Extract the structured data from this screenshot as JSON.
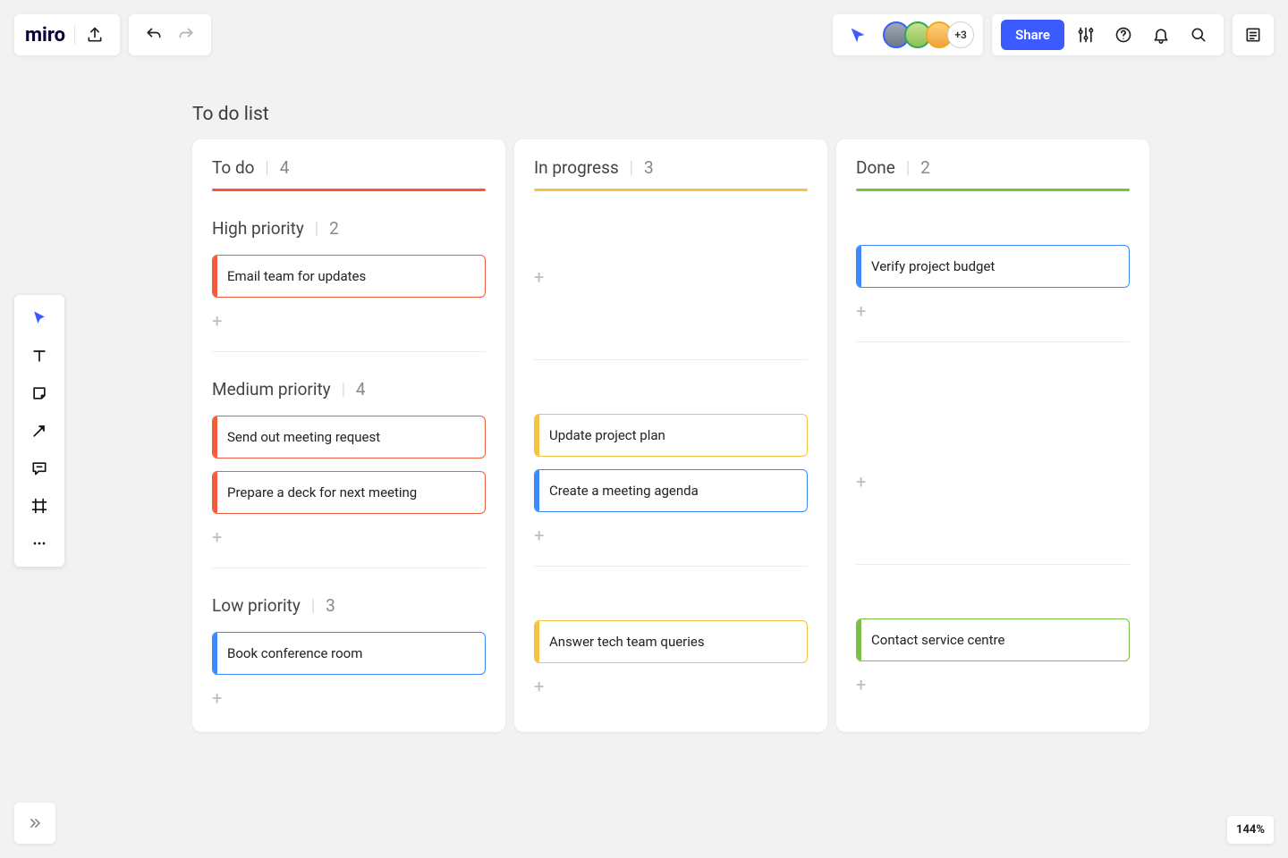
{
  "app": {
    "logo_text": "miro"
  },
  "topbar": {
    "overflow_count": "+3",
    "share_label": "Share"
  },
  "board": {
    "title": "To do list",
    "columns": [
      {
        "name": "To do",
        "count": 4,
        "underline_color": "#f35c3a"
      },
      {
        "name": "In progress",
        "count": 3,
        "underline_color": "#f5c242"
      },
      {
        "name": "Done",
        "count": 2,
        "underline_color": "#7bc043"
      }
    ],
    "sections": [
      {
        "name": "High priority",
        "count": 2
      },
      {
        "name": "Medium priority",
        "count": 4
      },
      {
        "name": "Low priority",
        "count": 3
      }
    ],
    "cards": {
      "todo_high": [
        {
          "text": "Email team for updates",
          "color": "red"
        }
      ],
      "todo_medium": [
        {
          "text": "Send out meeting request",
          "color": "red"
        },
        {
          "text": "Prepare a deck for next meeting",
          "color": "red"
        }
      ],
      "todo_low": [
        {
          "text": "Book conference room",
          "color": "blue"
        }
      ],
      "prog_medium": [
        {
          "text": "Update project plan",
          "color": "yellow"
        },
        {
          "text": "Create a meeting agenda",
          "color": "blue"
        }
      ],
      "prog_low": [
        {
          "text": "Answer tech team queries",
          "color": "yellow"
        }
      ],
      "done_high": [
        {
          "text": "Verify project budget",
          "color": "blue"
        }
      ],
      "done_low": [
        {
          "text": "Contact service centre",
          "color": "green"
        }
      ]
    }
  },
  "zoom": {
    "level": "144%"
  }
}
